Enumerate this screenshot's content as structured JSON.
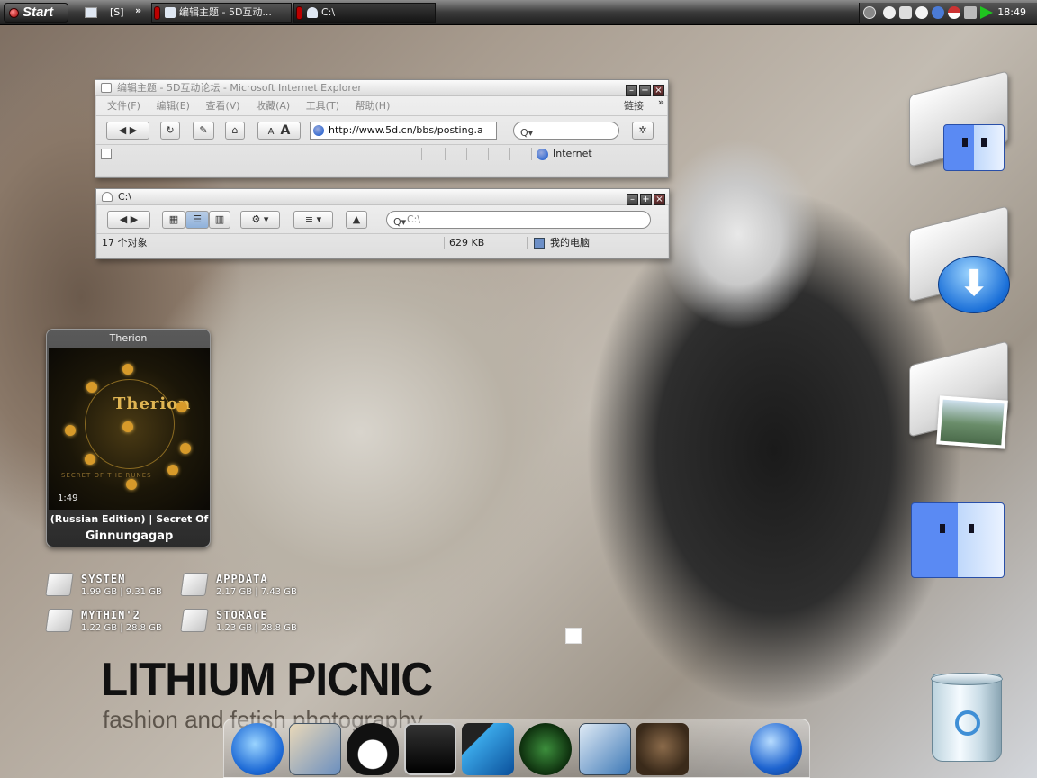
{
  "taskbar": {
    "start_label": "Start",
    "quicklaunch": [
      "[S]",
      "»"
    ],
    "tasks": [
      {
        "label": "编辑主题 - 5D互动..."
      },
      {
        "label": "C:\\"
      }
    ],
    "clock": "18:49",
    "tray_icons": [
      "back-icon",
      "messenger-icon",
      "shield-icon",
      "chat-icon",
      "security-icon",
      "flag-icon",
      "volume-icon",
      "play-icon"
    ]
  },
  "ie_window": {
    "title": "编辑主题 - 5D互动论坛 - Microsoft Internet Explorer",
    "menu": [
      "文件(F)",
      "编辑(E)",
      "查看(V)",
      "收藏(A)",
      "工具(T)",
      "帮助(H)"
    ],
    "links_label": "链接",
    "chevron": "»",
    "address": "http://www.5d.cn/bbs/posting.a",
    "font_small": "A",
    "font_large": "A",
    "status_zone": "Internet"
  },
  "explorer_window": {
    "title": "C:\\",
    "search_placeholder": "C:\\",
    "status_count": "17 个对象",
    "status_size": "629 KB",
    "status_location": "我的电脑"
  },
  "music_widget": {
    "title": "Therion",
    "band_art_text": "Therion",
    "art_subtitle": "SECRET OF THE RUNES",
    "time": "1:49",
    "album": "(Russian Edition) | Secret Of",
    "track": "Ginnungagap"
  },
  "drives": [
    {
      "name": "SYSTEM",
      "size": "1.99 GB | 9.31 GB"
    },
    {
      "name": "APPDATA",
      "size": "2.17 GB | 7.43 GB"
    },
    {
      "name": "MYTHIN'2",
      "size": "1.22 GB | 28.8 GB"
    },
    {
      "name": "STORAGE",
      "size": "1.23 GB | 28.8 GB"
    }
  ],
  "wallpaper": {
    "brand": "LITHIUM PICNIC",
    "tagline": "fashion and fetish photography"
  },
  "dock_apps": [
    "internet-explorer-icon",
    "mail-icon",
    "penguin-icon",
    "foobar-icon",
    "video-icon",
    "radar-icon",
    "preview-icon",
    "game-icon",
    "network-globe-icon"
  ]
}
